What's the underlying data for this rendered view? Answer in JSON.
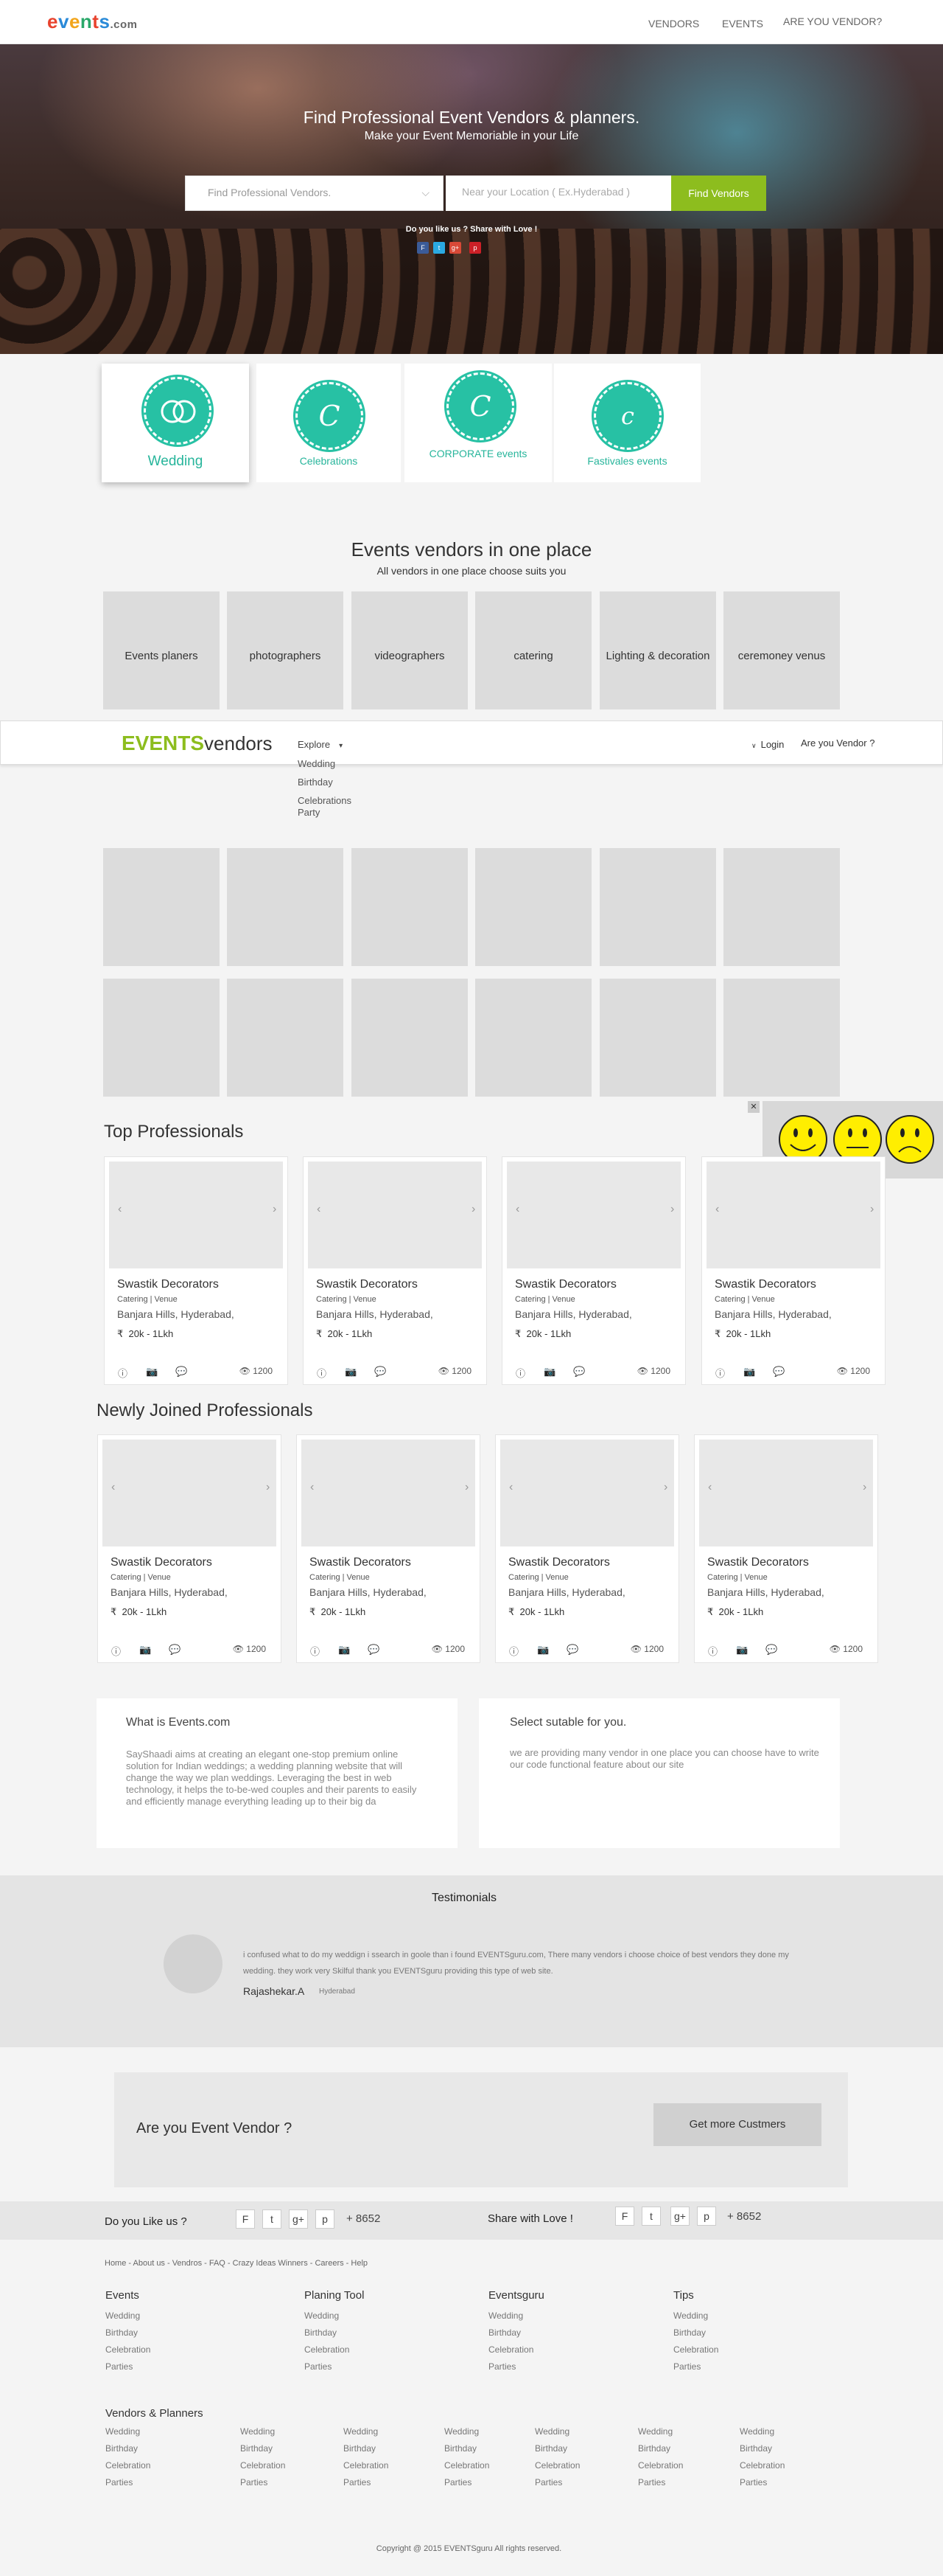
{
  "header": {
    "logo_e": "e",
    "logo_v": "v",
    "logo_ents": "ents",
    "logo_dotcom": ".com",
    "nav": [
      "VENDORS",
      "EVENTS",
      "ARE YOU VENDOR?"
    ]
  },
  "hero": {
    "title": "Find Professional Event Vendors & planners.",
    "subtitle": "Make your Event Memoriable in your Life",
    "search_placeholder": "Find Professional Vendors.",
    "location_placeholder": "Near your Location ( Ex.Hyderabad )",
    "find_button": "Find Vendors",
    "like_text": "Do you like us ? Share with Love !",
    "social": [
      "F",
      "t",
      "g+",
      "p"
    ]
  },
  "categories": [
    {
      "label": "Wedding",
      "letter": ""
    },
    {
      "label": "Celebrations",
      "letter": "C"
    },
    {
      "label": "CORPORATE events",
      "letter": "C"
    },
    {
      "label": "Fastivales events",
      "letter": "c"
    }
  ],
  "vendors_section": {
    "title": "Events vendors in one place",
    "subtitle": "All vendors in one place choose suits you",
    "tiles": [
      "Events planers",
      "photographers",
      "videographers",
      "catering",
      "Lighting & decoration",
      "ceremoney venus"
    ]
  },
  "nav2": {
    "logo_a": "EVENTS",
    "logo_b": "vendors",
    "explore": "Explore",
    "dropdown": [
      "Wedding",
      "Birthday",
      "Celebrations",
      "Party"
    ],
    "login": "Login",
    "vendor": "Are you Vendor ?"
  },
  "top_pros": {
    "title": "Top Professionals"
  },
  "new_pros": {
    "title": "Newly Joined Professionals"
  },
  "card": {
    "name": "Swastik Decorators",
    "category": "Catering  |  Venue",
    "address": "Banjara Hills, Hyderabad,",
    "price": "20k - 1Lkh",
    "views": "1200",
    "rupee": "₹"
  },
  "about": {
    "title": "What is Events.com",
    "body": "SayShaadi aims at creating an elegant one-stop premium online solution for Indian weddings; a wedding planning website that will change the way we plan weddings. Leveraging the best in web technology, it helps the to-be-wed couples and their parents to easily and efficiently manage everything leading up to their big da"
  },
  "select": {
    "title": "Select sutable for you.",
    "body": "we are providing many vendor in one place you can choose have to write our code functional feature about our site"
  },
  "testimonials": {
    "title": "Testimonials",
    "quote": "i confused what to do my weddign i ssearch in goole than i found EVENTSguru.com, There many vendors i choose choice of best vendors they done my wedding. they work very Skilful thank you EVENTSguru providing this type of web site.",
    "name": "Rajashekar.A",
    "city": "Hyderabad"
  },
  "cta": {
    "title": "Are you Event Vendor ?",
    "button": "Get more Custmers"
  },
  "share": {
    "like": "Do you Like us ?",
    "love": "Share with Love !",
    "icons": [
      "F",
      "t",
      "g+",
      "p"
    ],
    "count": "+ 8652"
  },
  "footer": {
    "links": "Home - About us - Vendros - FAQ - Crazy Ideas Winners - Careers - Help",
    "cols": [
      {
        "title": "Events"
      },
      {
        "title": "Planing Tool"
      },
      {
        "title": "Eventsguru"
      },
      {
        "title": "Tips"
      }
    ],
    "items": [
      "Wedding",
      "Birthday",
      "Celebration",
      "Parties"
    ],
    "vp_title": "Vendors &  Planners",
    "copyright": "Copyright @ 2015 EVENTSguru All rights reserved."
  },
  "colors": {
    "accent": "#8dbd1e",
    "teal": "#27c1a4",
    "emoji": "#ffee00"
  }
}
